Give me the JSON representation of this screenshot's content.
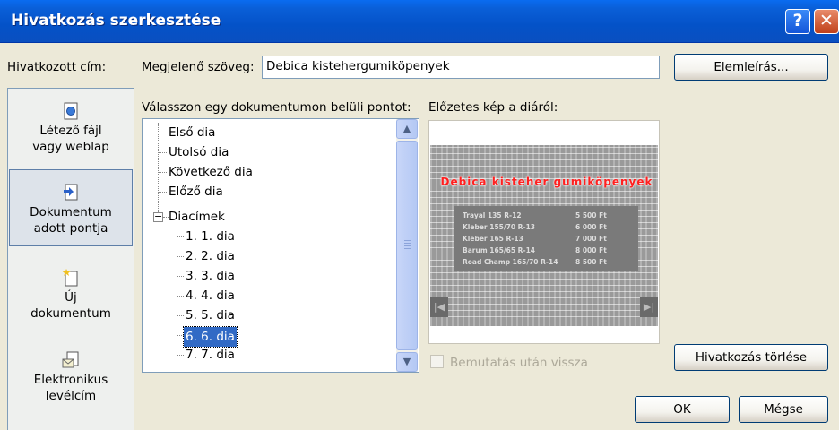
{
  "window": {
    "title": "Hivatkozás szerkesztése"
  },
  "labels": {
    "linked_to": "Hivatkozott cím:",
    "display_text_label": "Megjelenő szöveg:",
    "select_place": "Válasszon egy dokumentumon belüli pontot:",
    "preview": "Előzetes kép a diáról:",
    "show_return": "Bemutatás után vissza"
  },
  "display_text_value": "Debica kistehergumiköpenyek",
  "buttons": {
    "screentip": "Elemleírás...",
    "remove_link": "Hivatkozás törlése",
    "ok": "OK",
    "cancel": "Mégse"
  },
  "nav": [
    {
      "line1": "Létező fájl",
      "line2": "vagy weblap",
      "icon": "existing-file-icon"
    },
    {
      "line1": "Dokumentum",
      "line2": "adott pontja",
      "icon": "document-place-icon",
      "selected": true
    },
    {
      "line1": "Új",
      "line2": "dokumentum",
      "icon": "new-document-icon"
    },
    {
      "line1": "Elektronikus",
      "line2": "levélcím",
      "icon": "email-icon"
    }
  ],
  "tree": [
    "Első dia",
    "Utolsó dia",
    "Következő dia",
    "Előző dia",
    "Diacímek",
    "1. 1. dia",
    "2. 2. dia",
    "3. 3. dia",
    "4. 4. dia",
    "5. 5. dia",
    "6. 6. dia",
    "7. 7. dia"
  ],
  "tree_selected": "6. 6. dia",
  "slide_preview": {
    "title": "Debica kisteher gumiköpenyek",
    "rows": [
      {
        "name": "Trayal 135 R-12",
        "price": "5 500 Ft"
      },
      {
        "name": "Kleber 155/70 R-13",
        "price": "6 000 Ft"
      },
      {
        "name": "Kleber 165 R-13",
        "price": "7 000 Ft"
      },
      {
        "name": "Barum 165/65 R-14",
        "price": "8 000 Ft"
      },
      {
        "name": "Road Champ 165/70 R-14",
        "price": "8 500 Ft"
      }
    ]
  }
}
